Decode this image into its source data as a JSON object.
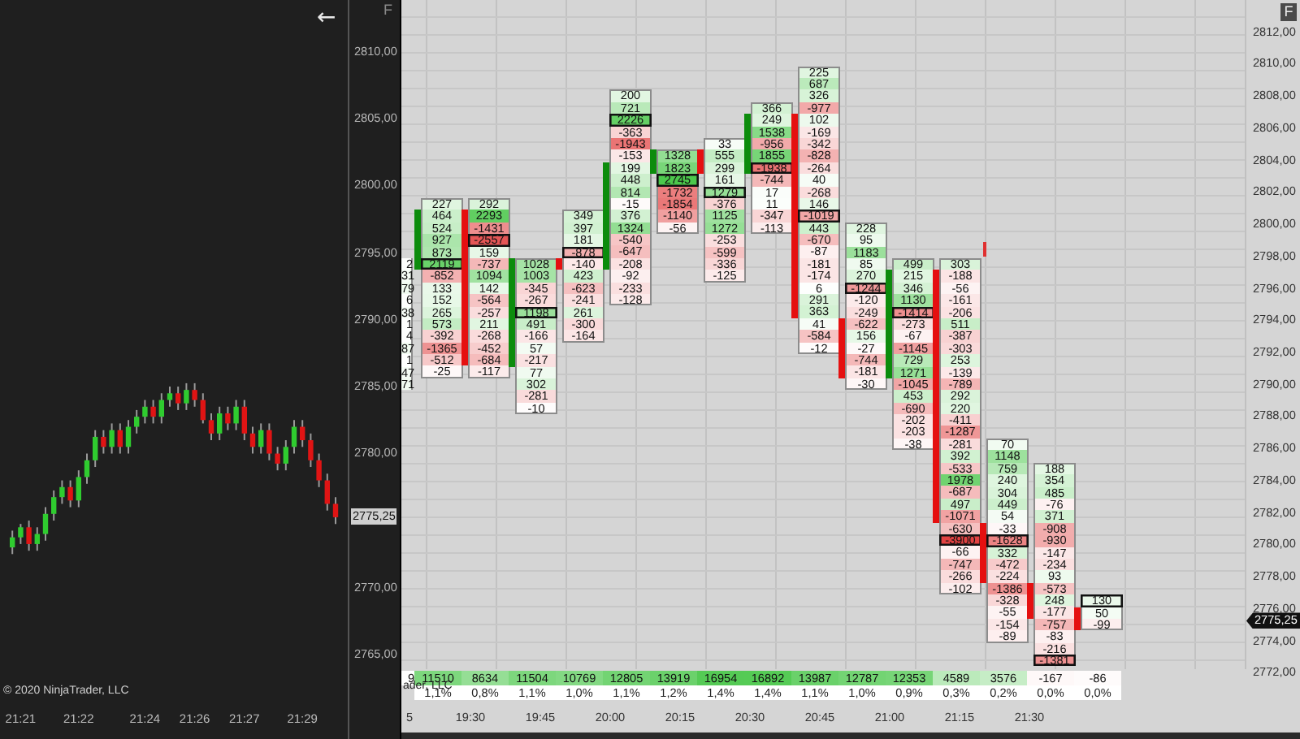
{
  "left_chart": {
    "back_arrow": "←",
    "panel_button": "F",
    "chart_data": {
      "type": "candlestick",
      "ohlc": [
        [
          2773.0,
          2774.25,
          2772.5,
          2773.75
        ],
        [
          2773.75,
          2774.75,
          2773.25,
          2774.5
        ],
        [
          2774.5,
          2775.0,
          2772.75,
          2773.25
        ],
        [
          2773.25,
          2774.5,
          2772.75,
          2774.0
        ],
        [
          2774.0,
          2776.0,
          2773.5,
          2775.5
        ],
        [
          2775.5,
          2777.25,
          2775.0,
          2776.75
        ],
        [
          2776.75,
          2778.0,
          2776.25,
          2777.5
        ],
        [
          2777.5,
          2778.0,
          2776.0,
          2776.5
        ],
        [
          2776.5,
          2778.75,
          2776.0,
          2778.25
        ],
        [
          2778.25,
          2780.0,
          2777.75,
          2779.5
        ],
        [
          2779.5,
          2781.75,
          2779.0,
          2781.25
        ],
        [
          2781.25,
          2781.75,
          2780.0,
          2780.5
        ],
        [
          2780.5,
          2782.25,
          2780.0,
          2781.75
        ],
        [
          2781.75,
          2782.25,
          2780.0,
          2780.5
        ],
        [
          2780.5,
          2782.5,
          2780.0,
          2782.0
        ],
        [
          2782.0,
          2783.25,
          2781.5,
          2782.75
        ],
        [
          2782.75,
          2784.0,
          2782.25,
          2783.5
        ],
        [
          2783.5,
          2784.0,
          2782.25,
          2782.75
        ],
        [
          2782.75,
          2784.5,
          2782.25,
          2784.0
        ],
        [
          2784.0,
          2785.0,
          2783.5,
          2784.5
        ],
        [
          2784.5,
          2785.0,
          2783.25,
          2783.75
        ],
        [
          2783.75,
          2785.25,
          2783.25,
          2784.75
        ],
        [
          2784.75,
          2785.25,
          2783.5,
          2784.0
        ],
        [
          2784.0,
          2784.5,
          2782.25,
          2782.5
        ],
        [
          2782.5,
          2783.0,
          2781.0,
          2781.5
        ],
        [
          2781.5,
          2783.5,
          2781.0,
          2783.0
        ],
        [
          2783.0,
          2783.5,
          2781.75,
          2782.25
        ],
        [
          2782.25,
          2784.0,
          2781.75,
          2783.5
        ],
        [
          2783.5,
          2784.0,
          2781.0,
          2781.5
        ],
        [
          2781.5,
          2782.0,
          2780.0,
          2780.5
        ],
        [
          2780.5,
          2782.25,
          2780.0,
          2781.75
        ],
        [
          2781.75,
          2782.25,
          2779.5,
          2780.0
        ],
        [
          2780.0,
          2780.5,
          2778.75,
          2779.25
        ],
        [
          2779.25,
          2781.0,
          2778.75,
          2780.5
        ],
        [
          2780.5,
          2782.5,
          2780.0,
          2782.0
        ],
        [
          2782.0,
          2782.5,
          2780.5,
          2781.0
        ],
        [
          2781.0,
          2781.5,
          2779.0,
          2779.5
        ],
        [
          2779.5,
          2780.0,
          2777.5,
          2778.0
        ],
        [
          2778.0,
          2778.5,
          2775.75,
          2776.25
        ],
        [
          2776.25,
          2776.75,
          2774.75,
          2775.25
        ]
      ],
      "ylim": [
        2758.7,
        2813.85
      ],
      "yticks": [
        {
          "value": 2810,
          "label": "2810,00"
        },
        {
          "value": 2805,
          "label": "2805,00"
        },
        {
          "value": 2800,
          "label": "2800,00"
        },
        {
          "value": 2795,
          "label": "2795,00"
        },
        {
          "value": 2790,
          "label": "2790,00"
        },
        {
          "value": 2785,
          "label": "2785,00"
        },
        {
          "value": 2780,
          "label": "2780,00"
        },
        {
          "value": 2770,
          "label": "2770,00"
        },
        {
          "value": 2765,
          "label": "2765,00"
        }
      ]
    },
    "time_labels": [
      "21:21",
      "21:22",
      "21:24",
      "21:26",
      "21:27",
      "21:29"
    ],
    "current_price": "2775,25",
    "copyright": "© 2020 NinjaTrader, LLC"
  },
  "footprint": {
    "panel_button": "F",
    "price_labels": [
      "2812,00",
      "2810,00",
      "2808,00",
      "2806,00",
      "2804,00",
      "2802,00",
      "2800,00",
      "2798,00",
      "2796,00",
      "2794,00",
      "2792,00",
      "2790,00",
      "2788,00",
      "2786,00",
      "2784,00",
      "2782,00",
      "2780,00",
      "2778,00",
      "2776,00",
      "2774,00",
      "2772,00"
    ],
    "current_price": "2775,25",
    "columns": [
      {
        "cells": [
          {
            "text": "2"
          },
          {
            "text": "31"
          },
          {
            "text": "79"
          },
          {
            "text": "6"
          },
          {
            "text": "38"
          },
          {
            "text": "1"
          },
          {
            "text": "4"
          },
          {
            "text": "87"
          },
          {
            "text": "1"
          },
          {
            "text": "47"
          },
          {
            "text": "71"
          }
        ]
      },
      {
        "color": "#0c8c0c",
        "cells": [
          {
            "text": "227",
            "poc": false,
            "body": false
          },
          {
            "text": "464",
            "poc": false,
            "body": true
          },
          {
            "text": "524",
            "poc": false,
            "body": true
          },
          {
            "text": "927",
            "poc": false,
            "body": true
          },
          {
            "text": "873",
            "poc": false,
            "body": true
          },
          {
            "text": "2119",
            "poc": true,
            "body": true
          },
          {
            "text": "-852",
            "poc": false,
            "body": false
          },
          {
            "text": "133",
            "poc": false,
            "body": false
          },
          {
            "text": "152",
            "poc": false,
            "body": false
          },
          {
            "text": "265",
            "poc": false,
            "body": false
          },
          {
            "text": "573",
            "poc": false,
            "body": false
          },
          {
            "text": "-392",
            "poc": false,
            "body": false
          },
          {
            "text": "-1365",
            "poc": false,
            "body": false
          },
          {
            "text": "-512",
            "poc": false,
            "body": false
          },
          {
            "text": "-25",
            "poc": false,
            "body": false
          }
        ]
      },
      {
        "color": "#e51010",
        "cells": [
          {
            "text": "292",
            "poc": false,
            "body": false
          },
          {
            "text": "2293",
            "poc": false,
            "body": true
          },
          {
            "text": "-1431",
            "poc": false,
            "body": true
          },
          {
            "text": "-2557",
            "poc": true,
            "body": true
          },
          {
            "text": "159",
            "poc": false,
            "body": true
          },
          {
            "text": "-737",
            "poc": false,
            "body": true
          },
          {
            "text": "1094",
            "poc": false,
            "body": true
          },
          {
            "text": "142",
            "poc": false,
            "body": true
          },
          {
            "text": "-564",
            "poc": false,
            "body": true
          },
          {
            "text": "-257",
            "poc": false,
            "body": true
          },
          {
            "text": "211",
            "poc": false,
            "body": true
          },
          {
            "text": "-268",
            "poc": false,
            "body": true
          },
          {
            "text": "-452",
            "poc": false,
            "body": true
          },
          {
            "text": "-684",
            "poc": false,
            "body": true
          },
          {
            "text": "-117",
            "poc": false,
            "body": false
          }
        ]
      },
      {
        "color": "#0c8c0c",
        "cells": [
          {
            "text": "1028",
            "poc": false,
            "body": true
          },
          {
            "text": "1003",
            "poc": false,
            "body": true
          },
          {
            "text": "-345",
            "poc": false,
            "body": true
          },
          {
            "text": "-267",
            "poc": false,
            "body": true
          },
          {
            "text": "1198",
            "poc": true,
            "body": true
          },
          {
            "text": "491",
            "poc": false,
            "body": true
          },
          {
            "text": "-166",
            "poc": false,
            "body": true
          },
          {
            "text": "57",
            "poc": false,
            "body": true
          },
          {
            "text": "-217",
            "poc": false,
            "body": true
          },
          {
            "text": "77",
            "poc": false,
            "body": false
          },
          {
            "text": "302",
            "poc": false,
            "body": false
          },
          {
            "text": "-281",
            "poc": false,
            "body": false
          },
          {
            "text": "-10",
            "poc": false,
            "body": false
          }
        ]
      },
      {
        "color": "#e51010",
        "cells": [
          {
            "text": "349",
            "poc": false,
            "body": false
          },
          {
            "text": "397",
            "poc": false,
            "body": false
          },
          {
            "text": "181",
            "poc": false,
            "body": false
          },
          {
            "text": "-878",
            "poc": true,
            "body": false
          },
          {
            "text": "-140",
            "poc": false,
            "body": true
          },
          {
            "text": "423",
            "poc": false,
            "body": false
          },
          {
            "text": "-623",
            "poc": false,
            "body": false
          },
          {
            "text": "-241",
            "poc": false,
            "body": false
          },
          {
            "text": "261",
            "poc": false,
            "body": false
          },
          {
            "text": "-300",
            "poc": false,
            "body": false
          },
          {
            "text": "-164",
            "poc": false,
            "body": false
          }
        ]
      },
      {
        "color": "#0c8c0c",
        "cells": [
          {
            "text": "200",
            "poc": false,
            "body": false
          },
          {
            "text": "721",
            "poc": false,
            "body": false
          },
          {
            "text": "2226",
            "poc": true,
            "body": false
          },
          {
            "text": "-363",
            "poc": false,
            "body": false
          },
          {
            "text": "-1943",
            "poc": false,
            "body": false
          },
          {
            "text": "-153",
            "poc": false,
            "body": false
          },
          {
            "text": "199",
            "poc": false,
            "body": true
          },
          {
            "text": "448",
            "poc": false,
            "body": true
          },
          {
            "text": "814",
            "poc": false,
            "body": true
          },
          {
            "text": "-15",
            "poc": false,
            "body": true
          },
          {
            "text": "376",
            "poc": false,
            "body": true
          },
          {
            "text": "1324",
            "poc": false,
            "body": true
          },
          {
            "text": "-540",
            "poc": false,
            "body": true
          },
          {
            "text": "-647",
            "poc": false,
            "body": true
          },
          {
            "text": "-208",
            "poc": false,
            "body": true
          },
          {
            "text": "-92",
            "poc": false,
            "body": false
          },
          {
            "text": "-233",
            "poc": false,
            "body": false
          },
          {
            "text": "-128",
            "poc": false,
            "body": false
          }
        ]
      },
      {
        "color": "#0c8c0c",
        "cells": [
          {
            "text": "1328",
            "poc": false,
            "body": true
          },
          {
            "text": "1823",
            "poc": false,
            "body": true
          },
          {
            "text": "2745",
            "poc": true,
            "body": false
          },
          {
            "text": "-1732",
            "poc": false,
            "body": false
          },
          {
            "text": "-1854",
            "poc": false,
            "body": false
          },
          {
            "text": "-1140",
            "poc": false,
            "body": false
          },
          {
            "text": "-56",
            "poc": false,
            "body": false
          }
        ]
      },
      {
        "color": "#e51010",
        "cells": [
          {
            "text": "33",
            "poc": false,
            "body": false
          },
          {
            "text": "555",
            "poc": false,
            "body": true
          },
          {
            "text": "299",
            "poc": false,
            "body": true
          },
          {
            "text": "161",
            "poc": false,
            "body": false
          },
          {
            "text": "1279",
            "poc": true,
            "body": false
          },
          {
            "text": "-376",
            "poc": false,
            "body": false
          },
          {
            "text": "1125",
            "poc": false,
            "body": false
          },
          {
            "text": "1272",
            "poc": false,
            "body": false
          },
          {
            "text": "-253",
            "poc": false,
            "body": false
          },
          {
            "text": "-599",
            "poc": false,
            "body": false
          },
          {
            "text": "-336",
            "poc": false,
            "body": false
          },
          {
            "text": "-125",
            "poc": false,
            "body": false
          }
        ]
      },
      {
        "color": "#0c8c0c",
        "cells": [
          {
            "text": "366",
            "poc": false,
            "body": false
          },
          {
            "text": "249",
            "poc": false,
            "body": true
          },
          {
            "text": "1538",
            "poc": false,
            "body": true
          },
          {
            "text": "-956",
            "poc": false,
            "body": true
          },
          {
            "text": "1855",
            "poc": false,
            "body": true
          },
          {
            "text": "-1938",
            "poc": true,
            "body": true
          },
          {
            "text": "-744",
            "poc": false,
            "body": false
          },
          {
            "text": "17",
            "poc": false,
            "body": false
          },
          {
            "text": "11",
            "poc": false,
            "body": false
          },
          {
            "text": "-347",
            "poc": false,
            "body": false
          },
          {
            "text": "-113",
            "poc": false,
            "body": false
          }
        ]
      },
      {
        "color": "#e51010",
        "cells": [
          {
            "text": "225",
            "poc": false,
            "body": false
          },
          {
            "text": "687",
            "poc": false,
            "body": false
          },
          {
            "text": "326",
            "poc": false,
            "body": false
          },
          {
            "text": "-977",
            "poc": false,
            "body": false
          },
          {
            "text": "102",
            "poc": false,
            "body": true
          },
          {
            "text": "-169",
            "poc": false,
            "body": true
          },
          {
            "text": "-342",
            "poc": false,
            "body": true
          },
          {
            "text": "-828",
            "poc": false,
            "body": true
          },
          {
            "text": "-264",
            "poc": false,
            "body": true
          },
          {
            "text": "40",
            "poc": false,
            "body": true
          },
          {
            "text": "-268",
            "poc": false,
            "body": true
          },
          {
            "text": "146",
            "poc": false,
            "body": true
          },
          {
            "text": "-1019",
            "poc": true,
            "body": true
          },
          {
            "text": "443",
            "poc": false,
            "body": true
          },
          {
            "text": "-670",
            "poc": false,
            "body": true
          },
          {
            "text": "-87",
            "poc": false,
            "body": true
          },
          {
            "text": "-181",
            "poc": false,
            "body": true
          },
          {
            "text": "-174",
            "poc": false,
            "body": true
          },
          {
            "text": "6",
            "poc": false,
            "body": true
          },
          {
            "text": "291",
            "poc": false,
            "body": true
          },
          {
            "text": "363",
            "poc": false,
            "body": true
          },
          {
            "text": "41",
            "poc": false,
            "body": false
          },
          {
            "text": "-584",
            "poc": false,
            "body": false
          },
          {
            "text": "-12",
            "poc": false,
            "body": false
          }
        ]
      },
      {
        "color": "#e51010",
        "cells": [
          {
            "text": "228",
            "poc": false,
            "body": false
          },
          {
            "text": "95",
            "poc": false,
            "body": false
          },
          {
            "text": "1183",
            "poc": false,
            "body": false
          },
          {
            "text": "85",
            "poc": false,
            "body": false
          },
          {
            "text": "270",
            "poc": false,
            "body": false
          },
          {
            "text": "-1244",
            "poc": true,
            "body": false
          },
          {
            "text": "-120",
            "poc": false,
            "body": false
          },
          {
            "text": "-249",
            "poc": false,
            "body": false
          },
          {
            "text": "-622",
            "poc": false,
            "body": true
          },
          {
            "text": "156",
            "poc": false,
            "body": true
          },
          {
            "text": "-27",
            "poc": false,
            "body": true
          },
          {
            "text": "-744",
            "poc": false,
            "body": true
          },
          {
            "text": "-181",
            "poc": false,
            "body": true
          },
          {
            "text": "-30",
            "poc": false,
            "body": false
          }
        ]
      },
      {
        "color": "#0c8c0c",
        "cells": [
          {
            "text": "499",
            "poc": false,
            "body": false
          },
          {
            "text": "215",
            "poc": false,
            "body": true
          },
          {
            "text": "346",
            "poc": false,
            "body": true
          },
          {
            "text": "1130",
            "poc": false,
            "body": true
          },
          {
            "text": "-1414",
            "poc": true,
            "body": true
          },
          {
            "text": "-273",
            "poc": false,
            "body": true
          },
          {
            "text": "-67",
            "poc": false,
            "body": true
          },
          {
            "text": "-1145",
            "poc": false,
            "body": true
          },
          {
            "text": "729",
            "poc": false,
            "body": true
          },
          {
            "text": "1271",
            "poc": false,
            "body": true
          },
          {
            "text": "-1045",
            "poc": false,
            "body": false
          },
          {
            "text": "453",
            "poc": false,
            "body": false
          },
          {
            "text": "-690",
            "poc": false,
            "body": false
          },
          {
            "text": "-202",
            "poc": false,
            "body": false
          },
          {
            "text": "-203",
            "poc": false,
            "body": false
          },
          {
            "text": "-38",
            "poc": false,
            "body": false
          }
        ]
      },
      {
        "color": "#e51010",
        "cells": [
          {
            "text": "303",
            "poc": false,
            "body": false
          },
          {
            "text": "-188",
            "poc": false,
            "body": true
          },
          {
            "text": "-56",
            "poc": false,
            "body": true
          },
          {
            "text": "-161",
            "poc": false,
            "body": true
          },
          {
            "text": "-206",
            "poc": false,
            "body": true
          },
          {
            "text": "511",
            "poc": false,
            "body": true
          },
          {
            "text": "-387",
            "poc": false,
            "body": true
          },
          {
            "text": "-303",
            "poc": false,
            "body": true
          },
          {
            "text": "253",
            "poc": false,
            "body": true
          },
          {
            "text": "-139",
            "poc": false,
            "body": true
          },
          {
            "text": "-789",
            "poc": false,
            "body": true
          },
          {
            "text": "292",
            "poc": false,
            "body": true
          },
          {
            "text": "220",
            "poc": false,
            "body": true
          },
          {
            "text": "-411",
            "poc": false,
            "body": true
          },
          {
            "text": "-1287",
            "poc": false,
            "body": true
          },
          {
            "text": "-281",
            "poc": false,
            "body": true
          },
          {
            "text": "392",
            "poc": false,
            "body": true
          },
          {
            "text": "-533",
            "poc": false,
            "body": true
          },
          {
            "text": "1978",
            "poc": false,
            "body": true
          },
          {
            "text": "-687",
            "poc": false,
            "body": true
          },
          {
            "text": "497",
            "poc": false,
            "body": true
          },
          {
            "text": "-1071",
            "poc": false,
            "body": true
          },
          {
            "text": "-630",
            "poc": false,
            "body": false
          },
          {
            "text": "-3900",
            "poc": true,
            "body": false
          },
          {
            "text": "-66",
            "poc": false,
            "body": false
          },
          {
            "text": "-747",
            "poc": false,
            "body": false
          },
          {
            "text": "-266",
            "poc": false,
            "body": false
          },
          {
            "text": "-102",
            "poc": false,
            "body": false
          }
        ]
      },
      {
        "color": "#e51010",
        "cells": [
          {
            "text": "70",
            "poc": false,
            "body": false
          },
          {
            "text": "1148",
            "poc": false,
            "body": false
          },
          {
            "text": "759",
            "poc": false,
            "body": false
          },
          {
            "text": "240",
            "poc": false,
            "body": false
          },
          {
            "text": "304",
            "poc": false,
            "body": false
          },
          {
            "text": "449",
            "poc": false,
            "body": false
          },
          {
            "text": "54",
            "poc": false,
            "body": false
          },
          {
            "text": "-33",
            "poc": false,
            "body": true
          },
          {
            "text": "-1628",
            "poc": true,
            "body": true
          },
          {
            "text": "332",
            "poc": false,
            "body": true
          },
          {
            "text": "-472",
            "poc": false,
            "body": true
          },
          {
            "text": "-224",
            "poc": false,
            "body": true
          },
          {
            "text": "-1386",
            "poc": false,
            "body": false
          },
          {
            "text": "-328",
            "poc": false,
            "body": false
          },
          {
            "text": "-55",
            "poc": false,
            "body": false
          },
          {
            "text": "-154",
            "poc": false,
            "body": false
          },
          {
            "text": "-89",
            "poc": false,
            "body": false
          }
        ]
      },
      {
        "color": "#e51010",
        "cells": [
          {
            "text": "188",
            "poc": false,
            "body": false
          },
          {
            "text": "354",
            "poc": false,
            "body": false
          },
          {
            "text": "485",
            "poc": false,
            "body": false
          },
          {
            "text": "-76",
            "poc": false,
            "body": false
          },
          {
            "text": "371",
            "poc": false,
            "body": false
          },
          {
            "text": "-908",
            "poc": false,
            "body": false
          },
          {
            "text": "-930",
            "poc": false,
            "body": false
          },
          {
            "text": "-147",
            "poc": false,
            "body": false
          },
          {
            "text": "-234",
            "poc": false,
            "body": false
          },
          {
            "text": "93",
            "poc": false,
            "body": false
          },
          {
            "text": "-573",
            "poc": false,
            "body": true
          },
          {
            "text": "248",
            "poc": false,
            "body": true
          },
          {
            "text": "-177",
            "poc": false,
            "body": true
          },
          {
            "text": "-757",
            "poc": false,
            "body": false
          },
          {
            "text": "-83",
            "poc": false,
            "body": false
          },
          {
            "text": "-216",
            "poc": false,
            "body": false
          },
          {
            "text": "-1381",
            "poc": true,
            "body": false
          }
        ]
      },
      {
        "color": "#e51010",
        "cells": [
          {
            "text": "130",
            "poc": true,
            "body": false
          },
          {
            "text": "50",
            "poc": false,
            "body": true
          },
          {
            "text": "-99",
            "poc": false,
            "body": true
          }
        ]
      }
    ],
    "totals": [
      "9",
      "11510",
      "8634",
      "11504",
      "10769",
      "12805",
      "13919",
      "16954",
      "16892",
      "13987",
      "12787",
      "12353",
      "4589",
      "3576",
      "-167",
      "-86"
    ],
    "percentages": [
      "1,1%",
      "0,8%",
      "1,1%",
      "1,0%",
      "1,1%",
      "1,2%",
      "1,4%",
      "1,4%",
      "1,1%",
      "1,0%",
      "0,9%",
      "0,3%",
      "0,2%",
      "0,0%",
      "0,0%"
    ],
    "time_labels": [
      "5",
      "19:30",
      "19:45",
      "20:00",
      "20:15",
      "20:30",
      "20:45",
      "21:00",
      "21:15",
      "21:30"
    ],
    "copyright_fragment": "ader, LLC"
  }
}
